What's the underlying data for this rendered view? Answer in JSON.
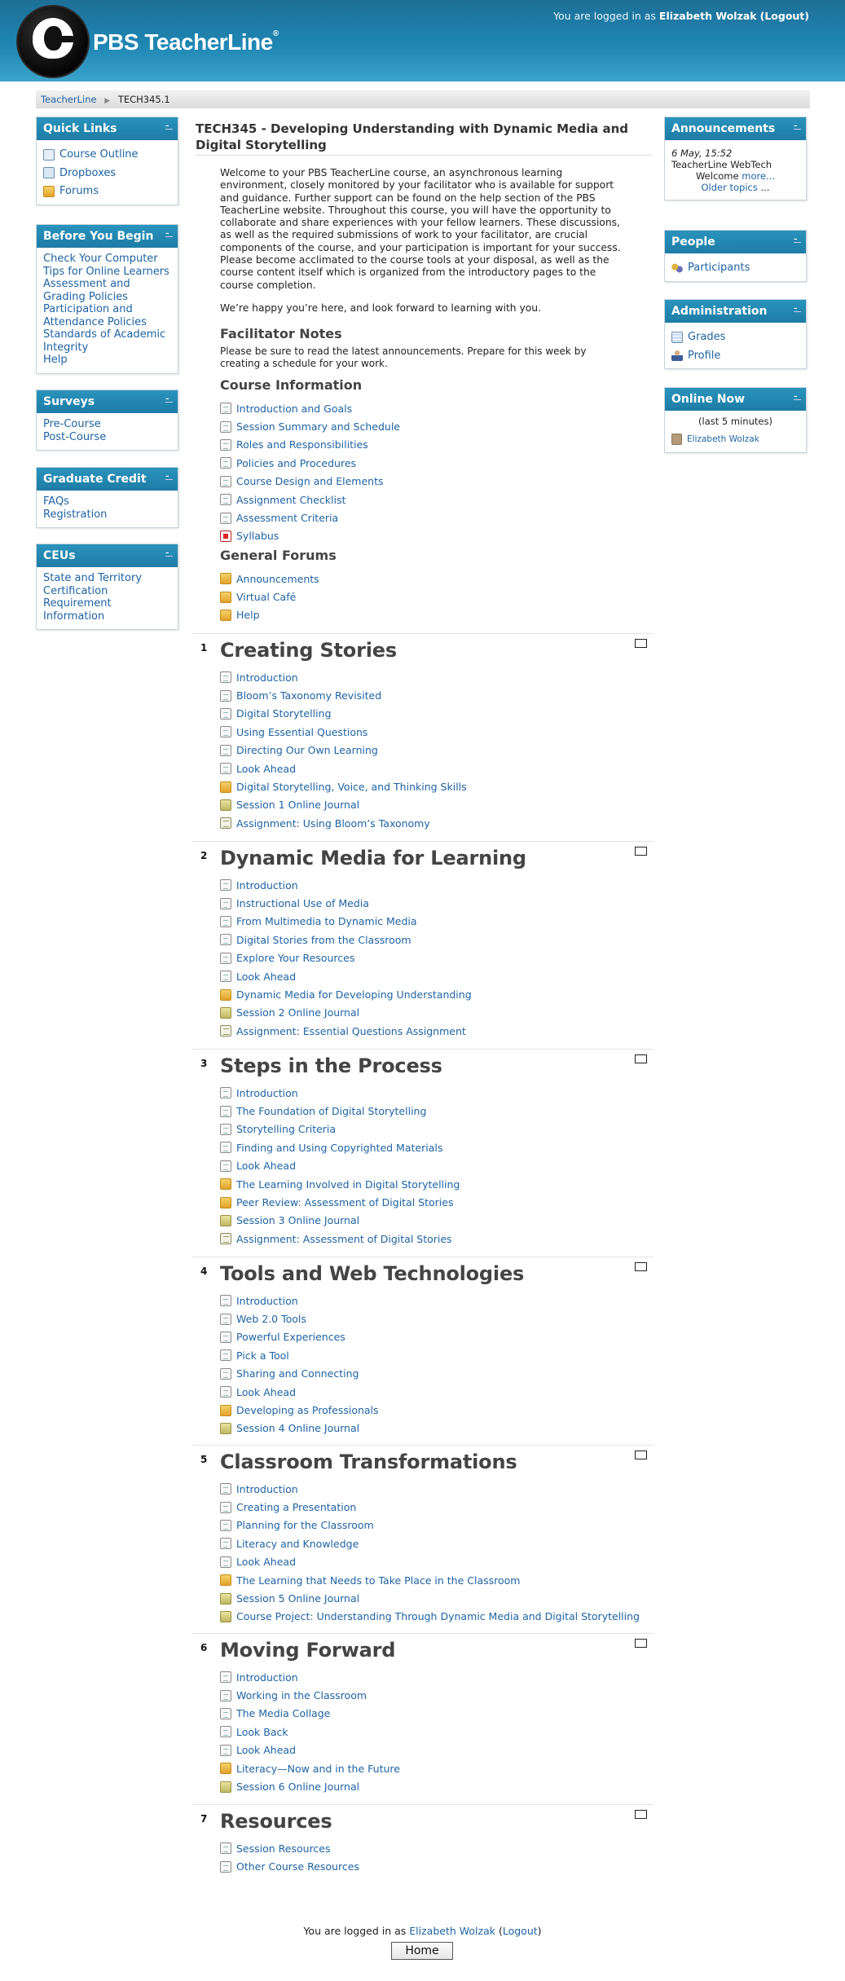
{
  "header": {
    "brand": "PBS TeacherLine",
    "login_prefix": "You are logged in as",
    "user_name": "Elizabeth Wolzak",
    "logout": "(Logout)"
  },
  "breadcrumb": [
    "TeacherLine",
    "TECH345.1"
  ],
  "left_blocks": [
    {
      "title": "Quick Links",
      "items": [
        {
          "label": "Course Outline",
          "icon": "course-outline-icon"
        },
        {
          "label": "Dropboxes",
          "icon": "dropbox-icon"
        },
        {
          "label": "Forums",
          "icon": "forum-icon"
        }
      ]
    },
    {
      "title": "Before You Begin",
      "items": [
        "Check Your Computer",
        "Tips for Online Learners",
        "Assessment and Grading Policies",
        "Participation and Attendance Policies",
        "Standards of Academic Integrity",
        "Help"
      ]
    },
    {
      "title": "Surveys",
      "items": [
        "Pre-Course",
        "Post-Course"
      ]
    },
    {
      "title": "Graduate Credit",
      "items": [
        "FAQs",
        "Registration"
      ]
    },
    {
      "title": "CEUs",
      "items": [
        "State and Territory Certification Requirement Information"
      ]
    }
  ],
  "right_blocks": {
    "announcements": {
      "title": "Announcements",
      "date": "6 May, 15:52",
      "subject": "TeacherLine WebTech",
      "text": "Welcome",
      "more": "more...",
      "older": "Older topics",
      "ellipsis": "..."
    },
    "people": {
      "title": "People",
      "link": "Participants"
    },
    "administration": {
      "title": "Administration",
      "grades": "Grades",
      "profile": "Profile"
    },
    "online_now": {
      "title": "Online Now",
      "caption": "(last 5 minutes)",
      "user": "Elizabeth Wolzak"
    }
  },
  "course": {
    "title": "TECH345 - Developing Understanding with Dynamic Media and Digital Storytelling",
    "intro": "Welcome to your PBS TeacherLine course, an asynchronous learning environment, closely monitored by your facilitator who is available for support and guidance. Further support can be found on the help section of the PBS TeacherLine website. Throughout this course, you will have the opportunity to collaborate and share experiences with your fellow learners. These discussions, as well as the required submissions of work to your facilitator, are crucial components of the course, and your participation is important for your success. Please become acclimated to the course tools at your disposal, as well as the course content itself which is organized from the introductory pages to the course completion.",
    "intro2": "We’re happy you’re here, and look forward to learning with you.",
    "facilitator_heading": "Facilitator Notes",
    "facilitator_text": "Please be sure to read the latest announcements. Prepare for this week by creating a schedule for your work.",
    "course_info_heading": "Course Information",
    "course_info": [
      {
        "label": "Introduction and Goals",
        "type": "res"
      },
      {
        "label": "Session Summary and Schedule",
        "type": "res"
      },
      {
        "label": "Roles and Responsibilities",
        "type": "res"
      },
      {
        "label": "Policies and Procedures",
        "type": "res"
      },
      {
        "label": "Course Design and Elements",
        "type": "res"
      },
      {
        "label": "Assignment Checklist",
        "type": "res"
      },
      {
        "label": "Assessment Criteria",
        "type": "res"
      },
      {
        "label": "Syllabus",
        "type": "pdf"
      }
    ],
    "general_forums_heading": "General Forums",
    "general_forums": [
      {
        "label": "Announcements",
        "type": "forum"
      },
      {
        "label": "Virtual Café",
        "type": "forum"
      },
      {
        "label": "Help",
        "type": "forum"
      }
    ]
  },
  "sections": [
    {
      "num": "1",
      "title": "Creating Stories",
      "items": [
        {
          "label": "Introduction",
          "type": "res"
        },
        {
          "label": "Bloom’s Taxonomy Revisited",
          "type": "res"
        },
        {
          "label": "Digital Storytelling",
          "type": "res"
        },
        {
          "label": "Using Essential Questions",
          "type": "res"
        },
        {
          "label": "Directing Our Own Learning",
          "type": "res"
        },
        {
          "label": "Look Ahead",
          "type": "res"
        },
        {
          "label": "Digital Storytelling, Voice, and Thinking Skills",
          "type": "forum"
        },
        {
          "label": "Session 1 Online Journal",
          "type": "journal"
        },
        {
          "label": "Assignment: Using Bloom’s Taxonomy",
          "type": "assign"
        }
      ]
    },
    {
      "num": "2",
      "title": "Dynamic Media for Learning",
      "items": [
        {
          "label": "Introduction",
          "type": "res"
        },
        {
          "label": "Instructional Use of Media",
          "type": "res"
        },
        {
          "label": "From Multimedia to Dynamic Media",
          "type": "res"
        },
        {
          "label": "Digital Stories from the Classroom",
          "type": "res"
        },
        {
          "label": "Explore Your Resources",
          "type": "res"
        },
        {
          "label": "Look Ahead",
          "type": "res"
        },
        {
          "label": "Dynamic Media for Developing Understanding",
          "type": "forum"
        },
        {
          "label": "Session 2 Online Journal",
          "type": "journal"
        },
        {
          "label": "Assignment: Essential Questions Assignment",
          "type": "assign"
        }
      ]
    },
    {
      "num": "3",
      "title": "Steps in the Process",
      "items": [
        {
          "label": "Introduction",
          "type": "res"
        },
        {
          "label": "The Foundation of Digital Storytelling",
          "type": "res"
        },
        {
          "label": "Storytelling Criteria",
          "type": "res"
        },
        {
          "label": "Finding and Using Copyrighted Materials",
          "type": "res"
        },
        {
          "label": "Look Ahead",
          "type": "res"
        },
        {
          "label": "The Learning Involved in Digital Storytelling",
          "type": "forum"
        },
        {
          "label": "Peer Review: Assessment of Digital Stories",
          "type": "forum"
        },
        {
          "label": "Session 3 Online Journal",
          "type": "journal"
        },
        {
          "label": "Assignment: Assessment of Digital Stories",
          "type": "assign"
        }
      ]
    },
    {
      "num": "4",
      "title": "Tools and Web Technologies",
      "items": [
        {
          "label": "Introduction",
          "type": "res"
        },
        {
          "label": "Web 2.0 Tools",
          "type": "res"
        },
        {
          "label": "Powerful Experiences",
          "type": "res"
        },
        {
          "label": "Pick a Tool",
          "type": "res"
        },
        {
          "label": "Sharing and Connecting",
          "type": "res"
        },
        {
          "label": "Look Ahead",
          "type": "res"
        },
        {
          "label": "Developing as Professionals",
          "type": "forum"
        },
        {
          "label": "Session 4 Online Journal",
          "type": "journal"
        }
      ]
    },
    {
      "num": "5",
      "title": "Classroom Transformations",
      "items": [
        {
          "label": "Introduction",
          "type": "res"
        },
        {
          "label": "Creating a Presentation",
          "type": "res"
        },
        {
          "label": "Planning for the Classroom",
          "type": "res"
        },
        {
          "label": "Literacy and Knowledge",
          "type": "res"
        },
        {
          "label": "Look Ahead",
          "type": "res"
        },
        {
          "label": "The Learning that Needs to Take Place in the Classroom",
          "type": "forum"
        },
        {
          "label": "Session 5 Online Journal",
          "type": "journal"
        },
        {
          "label": "Course Project: Understanding Through Dynamic Media and Digital Storytelling",
          "type": "journal"
        }
      ]
    },
    {
      "num": "6",
      "title": "Moving Forward",
      "items": [
        {
          "label": "Introduction",
          "type": "res"
        },
        {
          "label": "Working in the Classroom",
          "type": "res"
        },
        {
          "label": "The Media Collage",
          "type": "res"
        },
        {
          "label": "Look Back",
          "type": "res"
        },
        {
          "label": "Look Ahead",
          "type": "res"
        },
        {
          "label": "Literacy—Now and in the Future",
          "type": "forum"
        },
        {
          "label": "Session 6 Online Journal",
          "type": "journal"
        }
      ]
    },
    {
      "num": "7",
      "title": "Resources",
      "items": [
        {
          "label": "Session Resources",
          "type": "res"
        },
        {
          "label": "Other Course Resources",
          "type": "res"
        }
      ]
    }
  ],
  "footer": {
    "login_prefix": "You are logged in as",
    "user_name": "Elizabeth Wolzak",
    "logout": "Logout",
    "home_button": "Home"
  }
}
